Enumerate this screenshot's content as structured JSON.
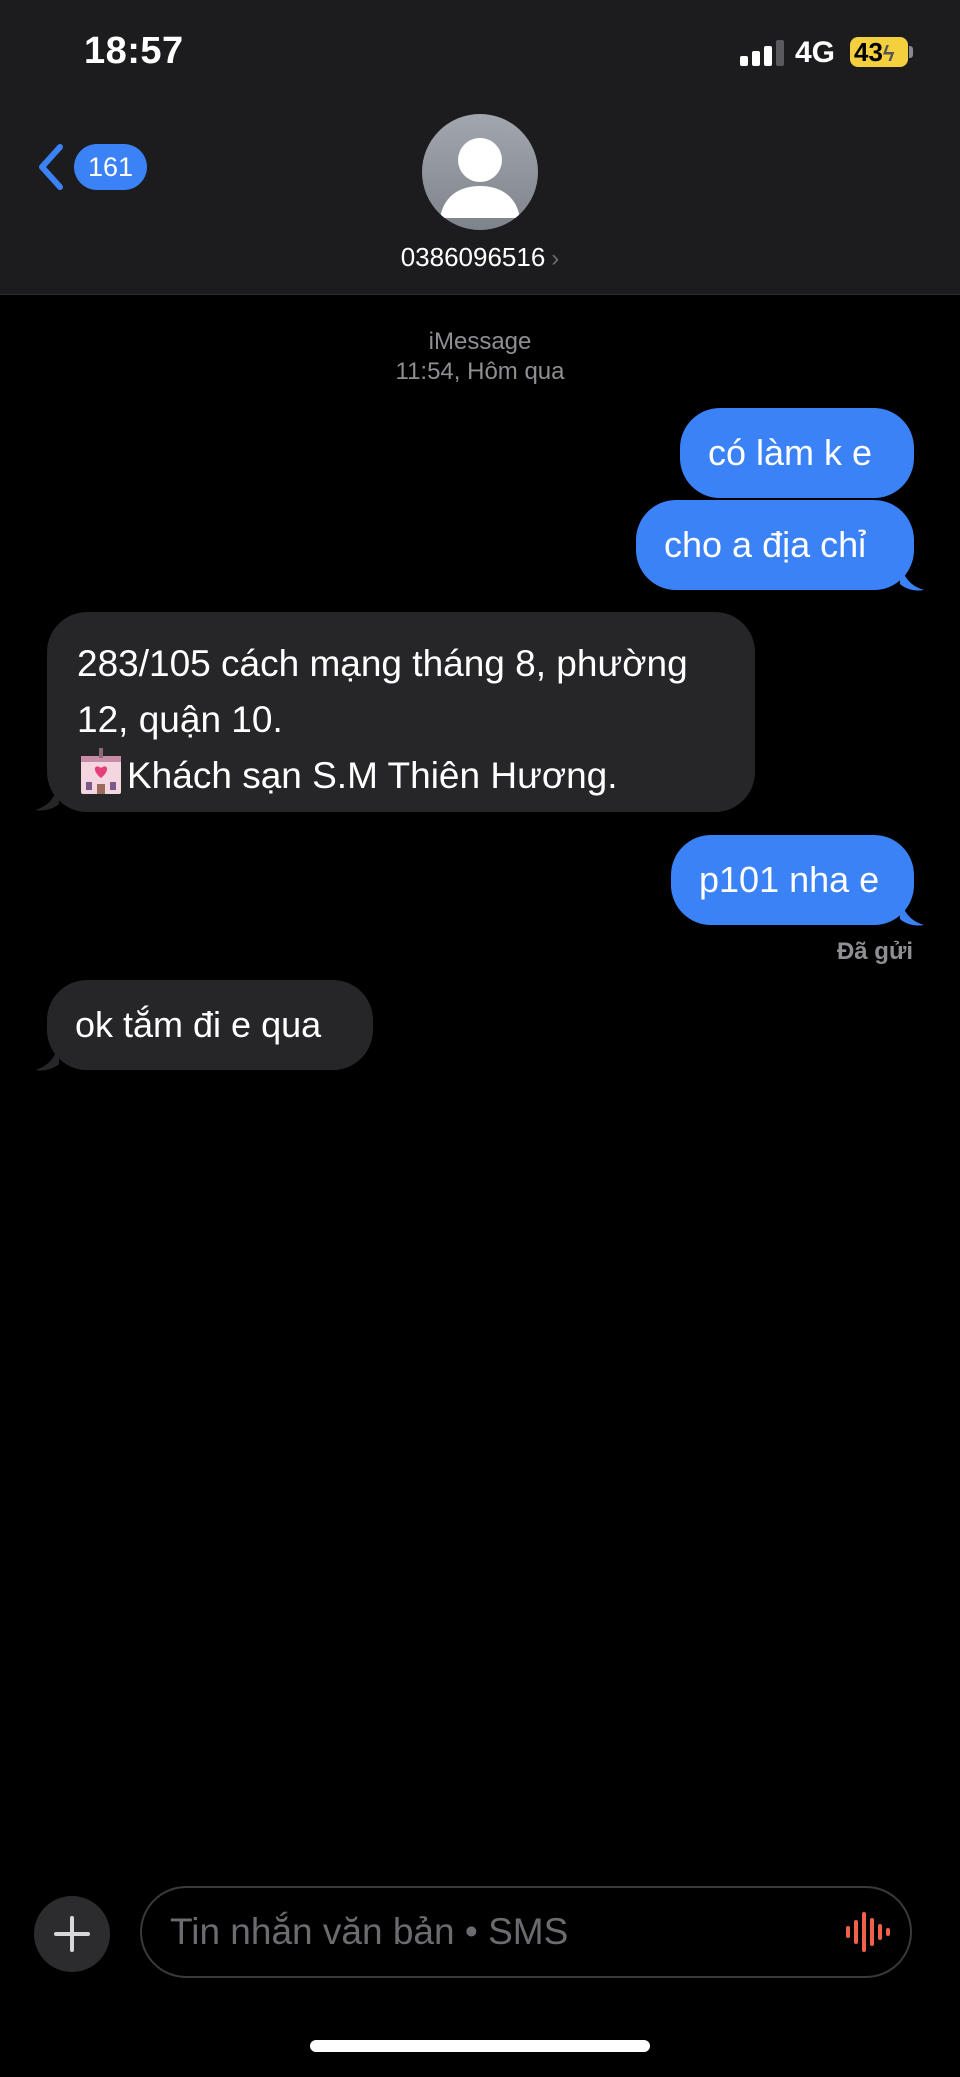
{
  "status_bar": {
    "time": "18:57",
    "network": "4G",
    "battery": "43",
    "signal_bars_active": 3,
    "signal_bars_total": 4
  },
  "header": {
    "back_badge": "161",
    "contact": "0386096516",
    "contact_chevron": "›"
  },
  "thread": {
    "service": "iMessage",
    "timestamp": "11:54, Hôm qua",
    "messages": [
      {
        "direction": "outgoing",
        "text": "có làm k e"
      },
      {
        "direction": "outgoing",
        "text": "cho a địa chỉ"
      },
      {
        "direction": "incoming",
        "lines": [
          "283/105 cách mạng tháng 8, phường",
          "12, quận 10.",
          "Khách sạn S.M Thiên Hương."
        ],
        "emoji": "love-hotel-icon"
      },
      {
        "direction": "outgoing",
        "text": "p101 nha e"
      },
      {
        "direction": "incoming",
        "text": "ok tắm đi e qua"
      }
    ],
    "delivered_label": "Đã gửi"
  },
  "composer": {
    "placeholder": "Tin nhắn văn bản • SMS",
    "plus_icon": "plus-icon",
    "audio_icon": "waveform-icon"
  },
  "colors": {
    "outgoing_bubble": "#3b82f6",
    "incoming_bubble": "#262628",
    "header_background": "#1c1c1e",
    "battery": "#f4d03f",
    "audio_icon": "#f2604c"
  }
}
